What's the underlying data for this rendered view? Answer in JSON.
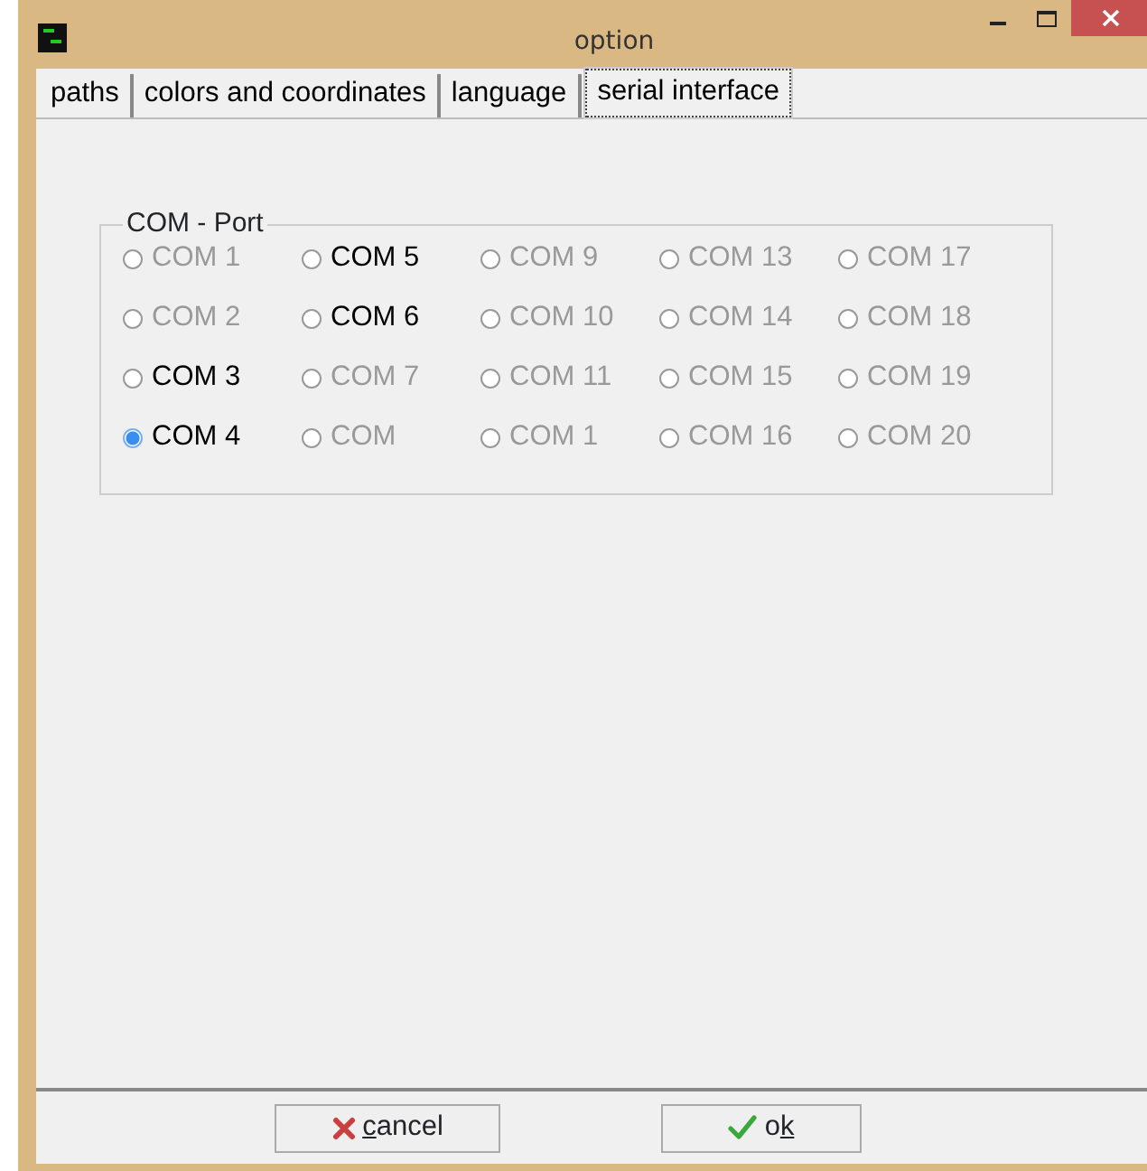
{
  "window": {
    "title": "option"
  },
  "tabs": [
    {
      "label": "paths",
      "selected": false
    },
    {
      "label": "colors and coordinates",
      "selected": false
    },
    {
      "label": "language",
      "selected": false
    },
    {
      "label": "serial interface",
      "selected": true
    }
  ],
  "com_port": {
    "title": "COM - Port",
    "columns": [
      [
        {
          "label": "COM 1",
          "disabled": true,
          "selected": false
        },
        {
          "label": "COM 2",
          "disabled": true,
          "selected": false
        },
        {
          "label": "COM 3",
          "disabled": false,
          "selected": false
        },
        {
          "label": "COM 4",
          "disabled": false,
          "selected": true
        }
      ],
      [
        {
          "label": "COM 5",
          "disabled": false,
          "selected": false
        },
        {
          "label": "COM 6",
          "disabled": false,
          "selected": false
        },
        {
          "label": "COM 7",
          "disabled": true,
          "selected": false
        },
        {
          "label": "COM",
          "disabled": true,
          "selected": false
        }
      ],
      [
        {
          "label": "COM 9",
          "disabled": true,
          "selected": false
        },
        {
          "label": "COM 10",
          "disabled": true,
          "selected": false
        },
        {
          "label": "COM 11",
          "disabled": true,
          "selected": false
        },
        {
          "label": "COM 1",
          "disabled": true,
          "selected": false
        }
      ],
      [
        {
          "label": "COM 13",
          "disabled": true,
          "selected": false
        },
        {
          "label": "COM 14",
          "disabled": true,
          "selected": false
        },
        {
          "label": "COM 15",
          "disabled": true,
          "selected": false
        },
        {
          "label": "COM 16",
          "disabled": true,
          "selected": false
        }
      ],
      [
        {
          "label": "COM 17",
          "disabled": true,
          "selected": false
        },
        {
          "label": "COM 18",
          "disabled": true,
          "selected": false
        },
        {
          "label": "COM 19",
          "disabled": true,
          "selected": false
        },
        {
          "label": "COM 20",
          "disabled": true,
          "selected": false
        }
      ]
    ]
  },
  "buttons": [
    {
      "kind": "cancel",
      "label_key": "c",
      "label_after": "ancel"
    },
    {
      "kind": "ok",
      "label_before": "o",
      "label_key": "k"
    }
  ]
}
